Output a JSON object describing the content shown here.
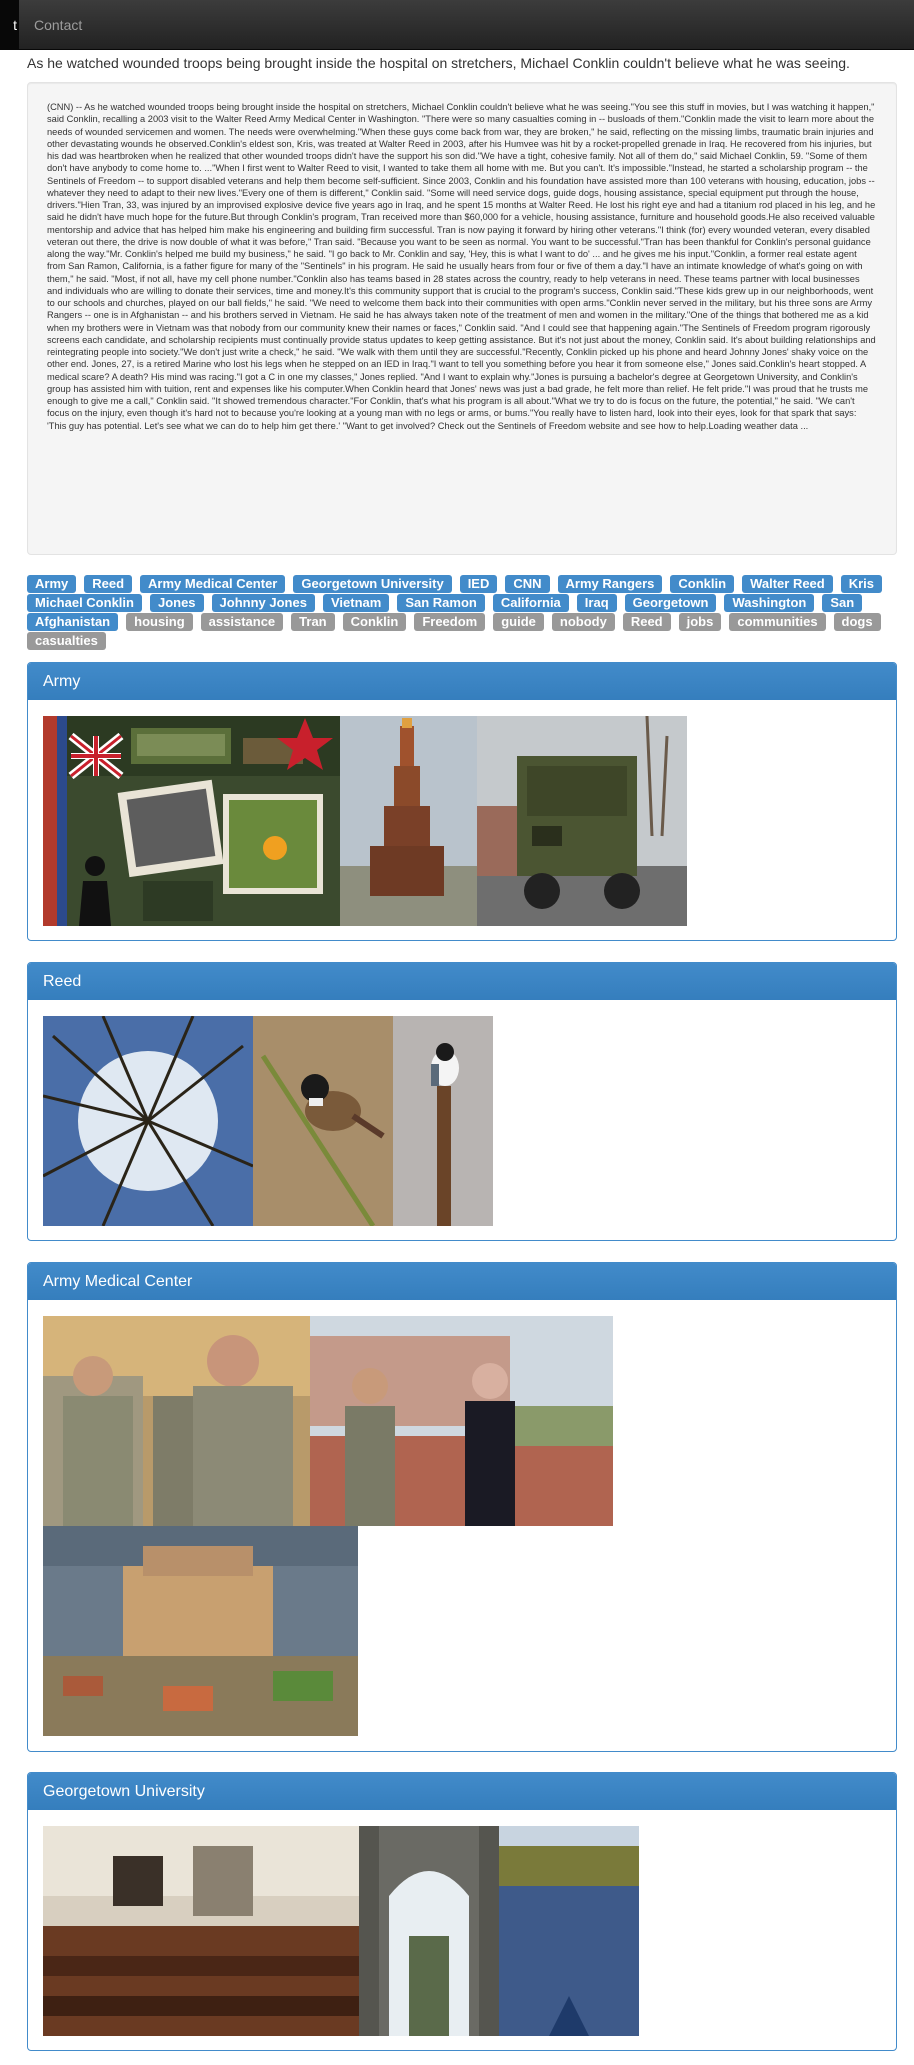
{
  "nav": {
    "active_label": "t",
    "contact_label": "Contact"
  },
  "headline": "As he watched wounded troops being brought inside the hospital on stretchers, Michael Conklin couldn't believe what he was seeing.",
  "article": "(CNN) -- As he watched wounded troops being brought inside the hospital on stretchers, Michael Conklin couldn't believe what he was seeing.\"You see this stuff in movies, but I was watching it happen,\" said Conklin, recalling a 2003 visit to the Walter Reed Army Medical Center in Washington. \"There were so many casualties coming in -- busloads of them.\"Conklin made the visit to learn more about the needs of wounded servicemen and women. The needs were overwhelming.\"When these guys come back from war, they are broken,\" he said, reflecting on the missing limbs, traumatic brain injuries and other devastating wounds he observed.Conklin's eldest son, Kris, was treated at Walter Reed in 2003, after his Humvee was hit by a rocket-propelled grenade in Iraq. He recovered from his injuries, but his dad was heartbroken when he realized that other wounded troops didn't have the support his son did.\"We have a tight, cohesive family. Not all of them do,\" said Michael Conklin, 59. \"Some of them don't have anybody to come home to. ...\"When I first went to Walter Reed to visit, I wanted to take them all home with me. But you can't. It's impossible.\"Instead, he started a scholarship program -- the Sentinels of Freedom -- to support disabled veterans and help them become self-sufficient. Since 2003, Conklin and his foundation have assisted more than 100 veterans with housing, education, jobs -- whatever they need to adapt to their new lives.\"Every one of them is different,\" Conklin said. \"Some will need service dogs, guide dogs, housing assistance, special equipment put through the house, drivers.\"Hien Tran, 33, was injured by an improvised explosive device five years ago in Iraq, and he spent 15 months at Walter Reed. He lost his right eye and had a titanium rod placed in his leg, and he said he didn't have much hope for the future.But through Conklin's program, Tran received more than $60,000 for a vehicle, housing assistance, furniture and household goods.He also received valuable mentorship and advice that has helped him make his engineering and building firm successful. Tran is now paying it forward by hiring other veterans.\"I think (for) every wounded veteran, every disabled veteran out there, the drive is now double of what it was before,\" Tran said. \"Because you want to be seen as normal. You want to be successful.\"Tran has been thankful for Conklin's personal guidance along the way.\"Mr. Conklin's helped me build my business,\" he said. \"I go back to Mr. Conklin and say, 'Hey, this is what I want to do' ... and he gives me his input.\"Conklin, a former real estate agent from San Ramon, California, is a father figure for many of the \"Sentinels\" in his program. He said he usually hears from four or five of them a day.\"I have an intimate knowledge of what's going on with them,\" he said. \"Most, if not all, have my cell phone number.\"Conklin also has teams based in 28 states across the country, ready to help veterans in need. These teams partner with local businesses and individuals who are willing to donate their services, time and money.It's this community support that is crucial to the program's success, Conklin said.\"These kids grew up in our neighborhoods, went to our schools and churches, played on our ball fields,\" he said. \"We need to welcome them back into their communities with open arms.\"Conklin never served in the military, but his three sons are Army Rangers -- one is in Afghanistan -- and his brothers served in Vietnam. He said he has always taken note of the treatment of men and women in the military.\"One of the things that bothered me as a kid when my brothers were in Vietnam was that nobody from our community knew their names or faces,\" Conklin said. \"And I could see that happening again.\"The Sentinels of Freedom program rigorously screens each candidate, and scholarship recipients must continually provide status updates to keep getting assistance. But it's not just about the money, Conklin said. It's about building relationships and reintegrating people into society.\"We don't just write a check,\" he said. \"We walk with them until they are successful.\"Recently, Conklin picked up his phone and heard Johnny Jones' shaky voice on the other end. Jones, 27, is a retired Marine who lost his legs when he stepped on an IED in Iraq.\"I want to tell you something before you hear it from someone else,\" Jones said.Conklin's heart stopped. A medical scare? A death? His mind was racing.\"I got a C in one my classes,\" Jones replied. \"And I want to explain why.\"Jones is pursuing a bachelor's degree at Georgetown University, and Conklin's group has assisted him with tuition, rent and expenses like his computer.When Conklin heard that Jones' news was just a bad grade, he felt more than relief. He felt pride.\"I was proud that he trusts me enough to give me a call,\" Conklin said. \"It showed tremendous character.\"For Conklin, that's what his program is all about.\"What we try to do is focus on the future, the potential,\" he said. \"We can't focus on the injury, even though it's hard not to because you're looking at a young man with no legs or arms, or bums.\"You really have to listen hard, look into their eyes, look for that spark that says: 'This guy has potential. Let's see what we can do to help him get there.' \"Want to get involved? Check out the Sentinels of Freedom website and see how to help.Loading weather data ...",
  "tags": [
    {
      "label": "Army",
      "color": "#428bca"
    },
    {
      "label": "Reed",
      "color": "#428bca"
    },
    {
      "label": "Army Medical Center",
      "color": "#428bca"
    },
    {
      "label": "Georgetown University",
      "color": "#428bca"
    },
    {
      "label": "IED",
      "color": "#428bca"
    },
    {
      "label": "CNN",
      "color": "#428bca"
    },
    {
      "label": "Army Rangers",
      "color": "#428bca"
    },
    {
      "label": "Conklin",
      "color": "#428bca"
    },
    {
      "label": "Walter Reed",
      "color": "#428bca"
    },
    {
      "label": "Kris",
      "color": "#428bca"
    },
    {
      "label": "Michael Conklin",
      "color": "#428bca"
    },
    {
      "label": "Jones",
      "color": "#428bca"
    },
    {
      "label": "Johnny Jones",
      "color": "#428bca"
    },
    {
      "label": "Vietnam",
      "color": "#428bca"
    },
    {
      "label": "San Ramon",
      "color": "#428bca"
    },
    {
      "label": "California",
      "color": "#428bca"
    },
    {
      "label": "Iraq",
      "color": "#428bca"
    },
    {
      "label": "Georgetown",
      "color": "#428bca"
    },
    {
      "label": "Washington",
      "color": "#428bca"
    },
    {
      "label": "San",
      "color": "#428bca"
    },
    {
      "label": "Afghanistan",
      "color": "#428bca"
    },
    {
      "label": "housing",
      "color": "#999999"
    },
    {
      "label": "assistance",
      "color": "#999999"
    },
    {
      "label": "Tran",
      "color": "#999999"
    },
    {
      "label": "Conklin",
      "color": "#999999"
    },
    {
      "label": "Freedom",
      "color": "#999999"
    },
    {
      "label": "guide",
      "color": "#999999"
    },
    {
      "label": "nobody",
      "color": "#999999"
    },
    {
      "label": "Reed",
      "color": "#999999"
    },
    {
      "label": "jobs",
      "color": "#999999"
    },
    {
      "label": "communities",
      "color": "#999999"
    },
    {
      "label": "dogs",
      "color": "#999999"
    },
    {
      "label": "casualties",
      "color": "#999999"
    }
  ],
  "panels": [
    {
      "title": "Army",
      "photos": [
        "army-collage-photo",
        "human-pyramid-photo",
        "military-truck-photo"
      ]
    },
    {
      "title": "Reed",
      "photos": [
        "reeds-sky-photo",
        "reed-bunting-bird-photo",
        "bird-on-cattail-photo"
      ]
    },
    {
      "title": "Army Medical Center",
      "photos": [
        "soldiers-talking-photo",
        "officials-on-terrace-photo",
        "aerial-medical-center-photo"
      ]
    },
    {
      "title": "Georgetown University",
      "photos": [
        "lecture-hall-photo",
        "stone-archway-photo",
        "river-photo"
      ]
    }
  ]
}
